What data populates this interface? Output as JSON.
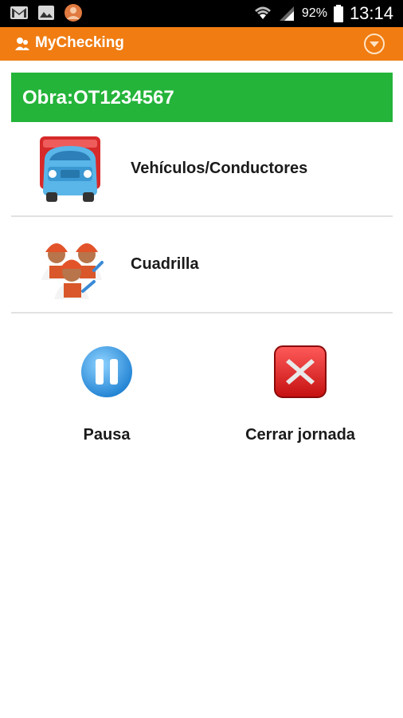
{
  "status_bar": {
    "icons": [
      "gmail-icon",
      "gallery-icon",
      "contact-icon"
    ],
    "battery_percent": "92%",
    "time": "13:14"
  },
  "action_bar": {
    "title": "MyChecking",
    "color": "#f07c12"
  },
  "obra": {
    "label": "Obra:OT1234567",
    "color": "#24b43a"
  },
  "menu": {
    "items": [
      {
        "label": "Vehículos/Conductores",
        "icon": "truck-icon"
      },
      {
        "label": "Cuadrilla",
        "icon": "workers-icon"
      }
    ]
  },
  "actions": {
    "pause_label": "Pausa",
    "close_label": "Cerrar jornada"
  }
}
